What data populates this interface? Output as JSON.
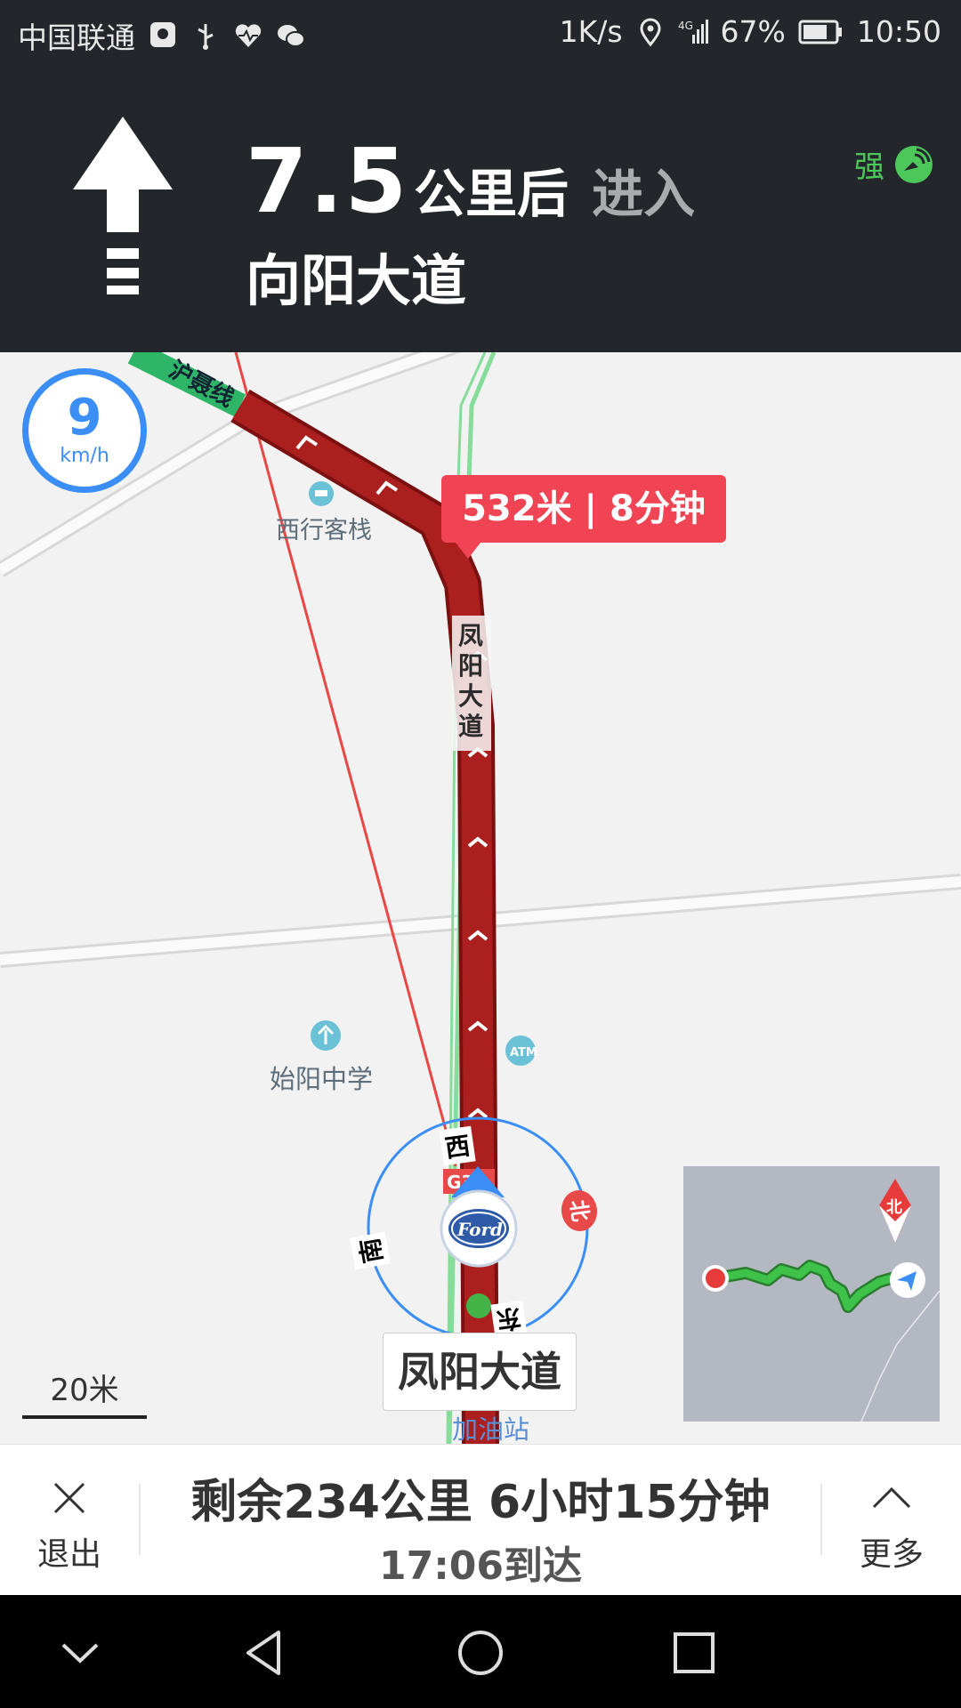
{
  "status_bar": {
    "carrier": "中国联通",
    "net_speed": "1K/s",
    "battery": "67%",
    "time": "10:50",
    "icons": [
      "baidu-icon",
      "usb-icon",
      "health-icon",
      "wechat-icon",
      "location-icon",
      "signal-4g-icon",
      "battery-icon"
    ]
  },
  "guidance": {
    "distance": "7.5",
    "unit": "公里后",
    "action": "进入",
    "road": "向阳大道",
    "gps_label": "强"
  },
  "map": {
    "speed_value": "9",
    "speed_unit": "km/h",
    "route_tip": "532米 | 8分钟",
    "pois": [
      "西行客栈",
      "始阳中学",
      "加油站"
    ],
    "road_labels": [
      "沪聂线",
      "凤阳大道"
    ],
    "highway_badge": "G3..",
    "compass": [
      "西",
      "北",
      "南",
      "东"
    ],
    "current_road": "凤阳大道",
    "scale": "20米",
    "minimap_north": "北"
  },
  "bottom_bar": {
    "exit_label": "退出",
    "remaining": "剩余234公里 6小时15分钟",
    "arrival": "17:06到达",
    "more_label": "更多"
  }
}
